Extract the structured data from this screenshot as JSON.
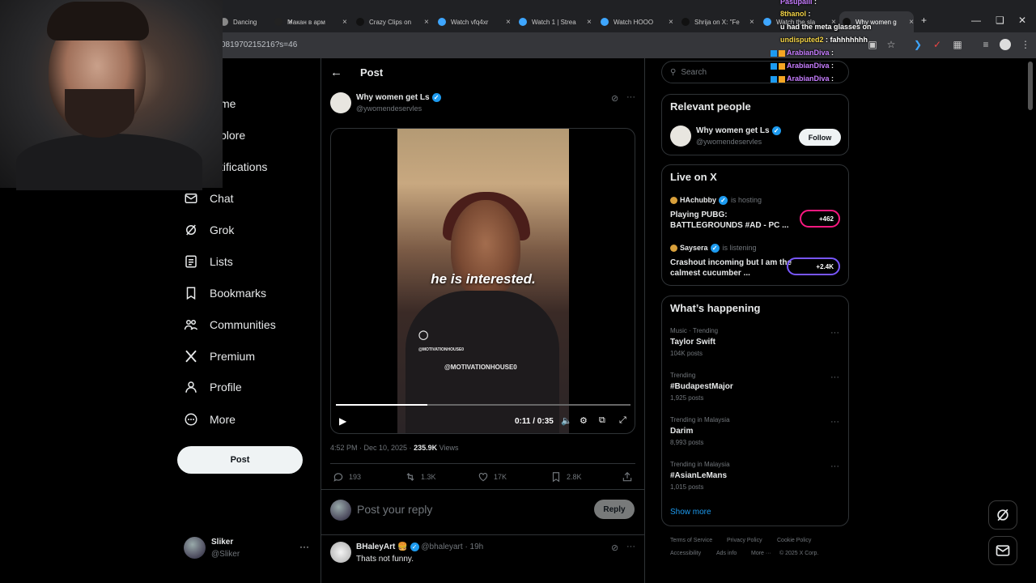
{
  "browser": {
    "tabs": [
      {
        "title": "Dancing",
        "favicon_color": "#888888"
      },
      {
        "title": "Макан в арм",
        "favicon_color": "#222222"
      },
      {
        "title": "Crazy Clips on",
        "favicon_color": "#111111"
      },
      {
        "title": "Watch vfq4xr",
        "favicon_color": "#3ea6ff"
      },
      {
        "title": "Watch 1 | Strea",
        "favicon_color": "#3ea6ff"
      },
      {
        "title": "Watch HOOO",
        "favicon_color": "#3ea6ff"
      },
      {
        "title": "Shrija on X: \"Fe",
        "favicon_color": "#111111"
      },
      {
        "title": "Watch the sla",
        "favicon_color": "#3ea6ff"
      },
      {
        "title": "Why women g",
        "favicon_color": "#111111"
      }
    ],
    "close_glyph": "×",
    "new_tab": "+",
    "url": "081970215216?s=46"
  },
  "chat": [
    {
      "user": "Pasupalli",
      "message": ""
    },
    {
      "user": "8thanol",
      "message": ""
    },
    {
      "user": "",
      "message": "u had the meta glasses on"
    },
    {
      "user": "undisputed2",
      "message": "fahhhhhhh"
    },
    {
      "user": "ArabianDiva",
      "message": ""
    },
    {
      "user": "ArabianDiva",
      "message": ""
    },
    {
      "user": "ArabianDiva",
      "message": ""
    }
  ],
  "nav": {
    "items": [
      {
        "label": "me",
        "icon": "home-icon"
      },
      {
        "label": "plore",
        "icon": "explore-icon"
      },
      {
        "label": "tifications",
        "icon": "bell-icon"
      },
      {
        "label": "Chat",
        "icon": "mail-icon"
      },
      {
        "label": "Grok",
        "icon": "grok-icon"
      },
      {
        "label": "Lists",
        "icon": "list-icon"
      },
      {
        "label": "Bookmarks",
        "icon": "bookmark-icon"
      },
      {
        "label": "Communities",
        "icon": "communities-icon"
      },
      {
        "label": "Premium",
        "icon": "x-logo-icon"
      },
      {
        "label": "Profile",
        "icon": "person-icon"
      },
      {
        "label": "More",
        "icon": "more-circle-icon"
      }
    ],
    "post_button": "Post",
    "account": {
      "name": "Sliker",
      "handle": "@Sliker",
      "more": "···"
    }
  },
  "main": {
    "header": "Post",
    "tweet": {
      "author": "Why women get Ls",
      "handle": "@ywomendeservles",
      "video": {
        "caption": "he is interested.",
        "watermark1": "@MOTIVATIONHOUSE0",
        "watermark2": "@MOTIVATIONHOUSE0",
        "time": "0:11 / 0:35",
        "progress": 0.31
      },
      "timestamp": "4:52 PM · Dec 10, 2025 ·",
      "views_count": "235.9K",
      "views_label": "Views",
      "replies": "193",
      "retweets": "1.3K",
      "likes": "17K",
      "bookmarks": "2.8K"
    },
    "reply_placeholder": "Post your reply",
    "reply_button": "Reply",
    "first_reply": {
      "author": "BHaleyArt 🍔",
      "handle": "@bhaleyart · 19h",
      "text": "Thats not funny."
    }
  },
  "sidebar": {
    "search_placeholder": "Search",
    "relevant_title": "Relevant people",
    "relevant": {
      "name": "Why women get Ls",
      "handle": "@ywomendeservles",
      "follow": "Follow"
    },
    "live_title": "Live on X",
    "live": [
      {
        "host": "HAchubby",
        "status": "is hosting",
        "title": "Playing PUBG: BATTLEGROUNDS #AD - PC ...",
        "count": "+462"
      },
      {
        "host": "Saysera",
        "status": "is listening",
        "title": "Crashout incoming but I am the calmest cucumber ...",
        "count": "+2.4K"
      }
    ],
    "happening_title": "What’s happening",
    "trends": [
      {
        "meta": "Music · Trending",
        "name": "Taylor Swift",
        "posts": "104K posts"
      },
      {
        "meta": "Trending",
        "name": "#BudapestMajor",
        "posts": "1,925 posts"
      },
      {
        "meta": "Trending in Malaysia",
        "name": "Darim",
        "posts": "8,993 posts"
      },
      {
        "meta": "Trending in Malaysia",
        "name": "#AsianLeMans",
        "posts": "1,015 posts"
      }
    ],
    "show_more": "Show more",
    "footer": [
      "Terms of Service",
      "Privacy Policy",
      "Cookie Policy",
      "Accessibility",
      "Ads info",
      "More ···",
      "© 2025 X Corp."
    ]
  },
  "colors": {
    "accent": "#1d9bf0",
    "background": "#000000",
    "border": "#2f3336",
    "muted": "#71767b"
  }
}
